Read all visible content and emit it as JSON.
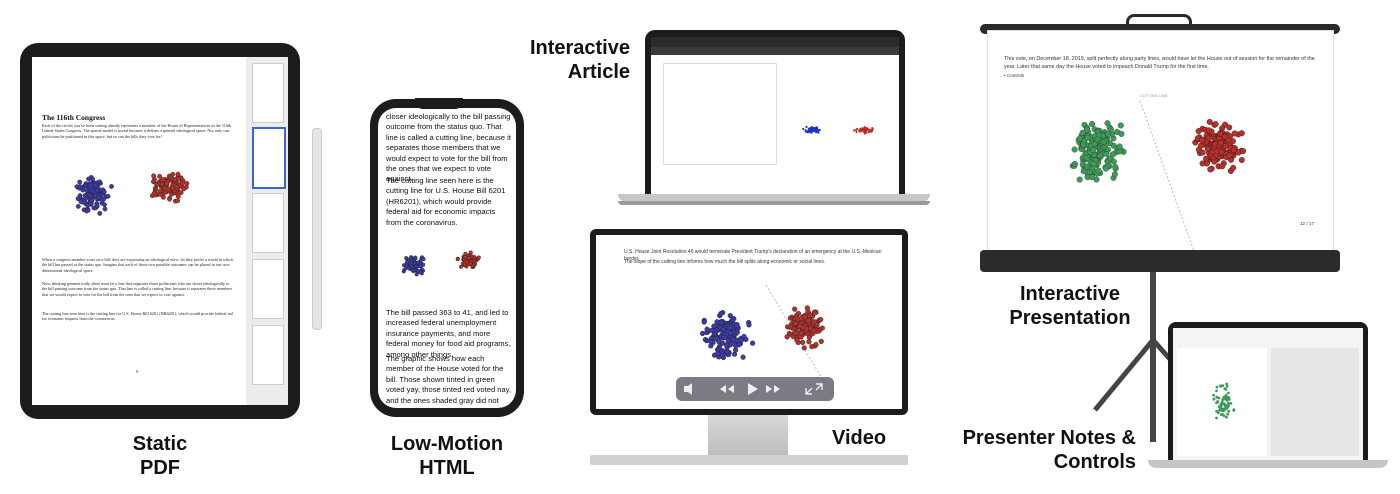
{
  "labels": {
    "static_pdf": [
      "Static",
      "PDF"
    ],
    "low_motion": [
      "Low-Motion",
      "HTML"
    ],
    "interactive_article": [
      "Interactive",
      "Article"
    ],
    "video": "Video",
    "interactive_presentation": [
      "Interactive",
      "Presentation"
    ],
    "presenter_notes": [
      "Presenter Notes &",
      "Controls"
    ]
  },
  "pdf": {
    "title": "The 116th Congress",
    "para1": "Each of the circles you've been sorting already represents a member of the House of Representatives in the 116th United States Congress. The spatial model is useful because it defines a general ideological space. Not only can politicians be positioned in this space, but so can the bills they vote for!",
    "para2": "When a congress member votes on a bill, they are expressing an ideological view: do they prefer a world in which the bill has passed or the status quo. Imagine that each of those two possible outcomes can be placed in our two-dimensional ideological space.",
    "para3": "Now, thinking geometrically, there must be a line that separates those politicians who are closer ideologically to the bill passing outcome from the status quo. That line is called a cutting line, because it separates those members that we would expect to vote for the bill from the ones that we expect to vote against.",
    "para4": "The cutting line seen here is the cutting line for U.S. House Bill 6201 (HR6201), which would provide federal aid for economic impacts from the coronavirus.",
    "page_number": "9"
  },
  "phone": {
    "p1": "closer ideologically to the bill passing outcome from the status quo. That line is called a cutting line, because it separates those members that we would expect to vote for the bill from the ones that we expect to vote against.",
    "p2": "The cutting line seen here is the cutting line for U.S. House Bill 6201 (HR6201), which would provide federal aid for economic impacts from the coronavirus.",
    "p3": "The bill passed 363 to 41, and led to increased federal unemployment insurance payments, and more federal money for food aid programs, among other things.",
    "p4": "The graphic shows how each member of the House voted for the bill. Those shown tinted in green voted yay, those tinted red voted nay, and the ones shaded gray did not vote."
  },
  "video": {
    "caption1": "U.S. House Joint Resolution 46 would terminate President Trump's declaration of an emergency at the U.S.-Mexican border.",
    "caption2": "The slope of the cutting line informs how much the bill splits along economic or social lines."
  },
  "presentation": {
    "text": "This vote, on December 18, 2019, split perfectly along party lines, would have let the House out of session for the remainder of the year. Later that same day the House voted to impeach Donald Trump for the first time.",
    "bullet": "Controls",
    "axis_label": "CUTTING LINE",
    "slide_counter": "12 / 17"
  },
  "colors": {
    "blue": "#3c3aa6",
    "red": "#b3322b",
    "green": "#3f9a5a",
    "device": "#1c1c1e"
  }
}
